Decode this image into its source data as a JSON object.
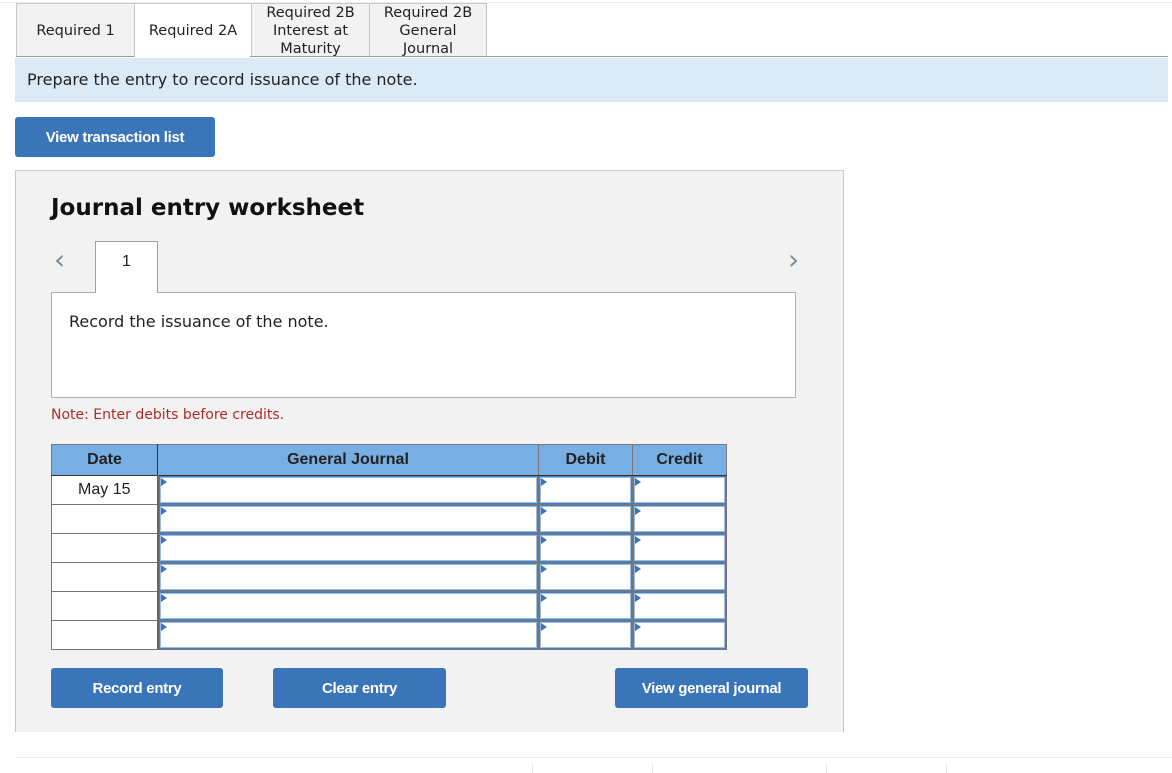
{
  "tabs": [
    {
      "label": "Required 1",
      "active": false
    },
    {
      "label": "Required 2A",
      "active": true
    },
    {
      "label": "Required 2B\nInterest at\nMaturity",
      "active": false
    },
    {
      "label": "Required 2B\nGeneral\nJournal",
      "active": false
    }
  ],
  "instruction": "Prepare the entry to record issuance of the note.",
  "view_transaction_list_label": "View transaction list",
  "worksheet": {
    "title": "Journal entry worksheet",
    "prev_icon": "‹",
    "next_icon": "›",
    "current_entry": "1",
    "entry_description": "Record the issuance of the note.",
    "note": "Note: Enter debits before credits.",
    "table": {
      "headers": {
        "date": "Date",
        "journal": "General Journal",
        "debit": "Debit",
        "credit": "Credit"
      },
      "rows": [
        {
          "date": "May 15",
          "account": "",
          "debit": "",
          "credit": ""
        },
        {
          "date": "",
          "account": "",
          "debit": "",
          "credit": ""
        },
        {
          "date": "",
          "account": "",
          "debit": "",
          "credit": ""
        },
        {
          "date": "",
          "account": "",
          "debit": "",
          "credit": ""
        },
        {
          "date": "",
          "account": "",
          "debit": "",
          "credit": ""
        },
        {
          "date": "",
          "account": "",
          "debit": "",
          "credit": ""
        }
      ]
    },
    "buttons": {
      "record": "Record entry",
      "clear": "Clear entry",
      "view_general_journal": "View general journal"
    }
  },
  "colors": {
    "accent": "#3a74b9",
    "instruction_bg": "#dbeaf7",
    "table_header": "#77aee3",
    "note": "#b12a25"
  }
}
